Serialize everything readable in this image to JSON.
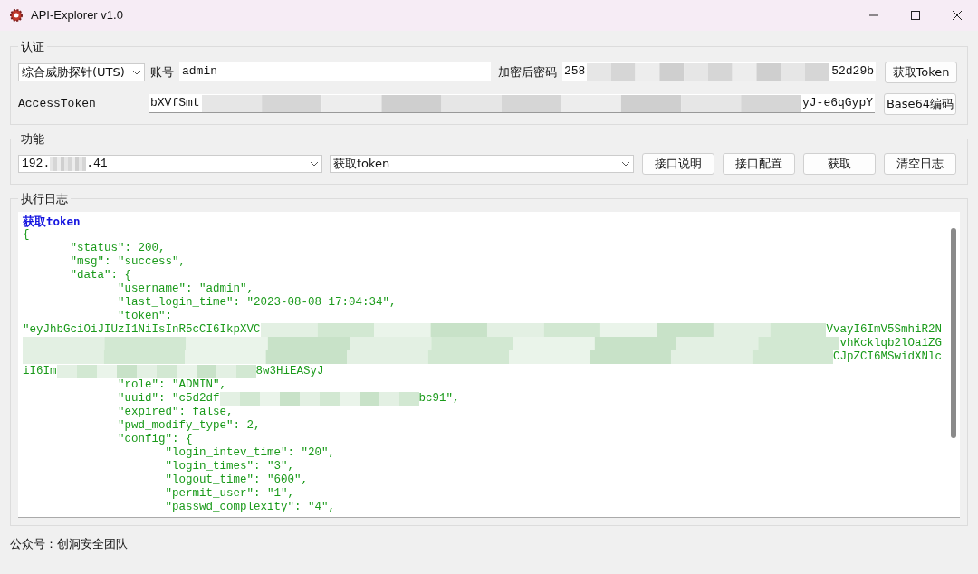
{
  "window": {
    "title": "API-Explorer v1.0"
  },
  "auth": {
    "title": "认证",
    "device_select": "综合威胁探针(UTS)",
    "account_label": "账号",
    "account_value": "admin",
    "password_label": "加密后密码",
    "password_start": "258",
    "password_end": "52d29b",
    "get_token_button": "获取Token",
    "token_label": "AccessToken",
    "token_start": "bXVfSmt",
    "token_end": "yJ-e6qGypY",
    "base64_button": "Base64编码"
  },
  "function": {
    "title": "功能",
    "host_start": "192.",
    "host_end": ".41",
    "api_select": "获取token",
    "buttons": [
      "接口说明",
      "接口配置",
      "获取",
      "清空日志"
    ]
  },
  "log": {
    "title": "执行日志",
    "lines": [
      {
        "kind": "heading",
        "text": "获取token"
      },
      {
        "kind": "plain",
        "text": "{"
      },
      {
        "kind": "plain",
        "text": "\t\"status\": 200,"
      },
      {
        "kind": "plain",
        "text": "\t\"msg\": \"success\","
      },
      {
        "kind": "plain",
        "text": "\t\"data\": {"
      },
      {
        "kind": "plain",
        "text": "\t\t\"username\": \"admin\","
      },
      {
        "kind": "plain",
        "text": "\t\t\"last_login_time\": \"2023-08-08 17:04:34\","
      },
      {
        "kind": "plain",
        "text": "\t\t\"token\":"
      },
      {
        "kind": "wide",
        "left": "\"eyJhbGciOiJIUzI1NiIsInR5cCI6IkpXVC",
        "right": "VvayI6ImV5SmhiR2N"
      },
      {
        "kind": "wide",
        "right": "vhKcklqb2lOa1ZG"
      },
      {
        "kind": "wide",
        "right": "CJpZCI6MSwidXNlc"
      },
      {
        "kind": "masked",
        "left": "iI6Im",
        "right": "8w3HiEASyJ"
      },
      {
        "kind": "plain",
        "text": "\t\t\"role\": \"ADMIN\","
      },
      {
        "kind": "masked",
        "left": "\t\t\"uuid\": \"c5d2df",
        "right": "bc91\","
      },
      {
        "kind": "plain",
        "text": "\t\t\"expired\": false,"
      },
      {
        "kind": "plain",
        "text": "\t\t\"pwd_modify_type\": 2,"
      },
      {
        "kind": "plain",
        "text": "\t\t\"config\": {"
      },
      {
        "kind": "plain",
        "text": "\t\t\t\"login_intev_time\": \"20\","
      },
      {
        "kind": "plain",
        "text": "\t\t\t\"login_times\": \"3\","
      },
      {
        "kind": "plain",
        "text": "\t\t\t\"logout_time\": \"600\","
      },
      {
        "kind": "plain",
        "text": "\t\t\t\"permit_user\": \"1\","
      },
      {
        "kind": "plain",
        "text": "\t\t\t\"passwd_complexity\": \"4\","
      }
    ]
  },
  "status_bar": "公众号：创洞安全团队"
}
